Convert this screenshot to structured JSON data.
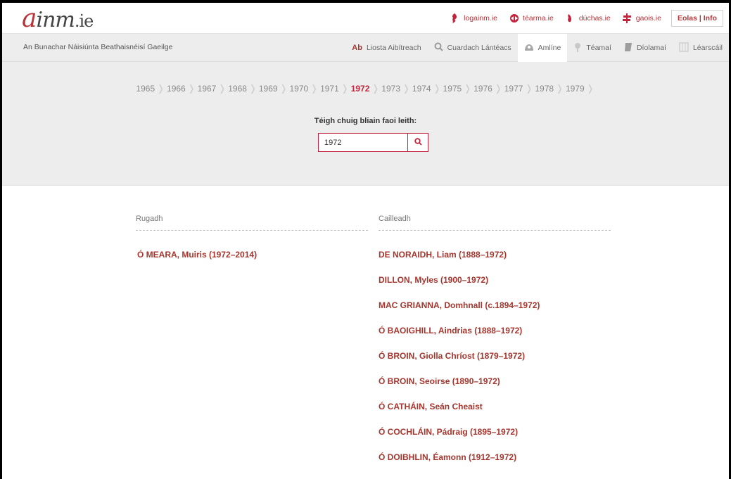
{
  "header": {
    "logo_prefix": "a",
    "logo_main": "inm",
    "logo_suffix": ".ie",
    "sitelinks": [
      {
        "label": "logainm.ie",
        "icon": "map-pin-icon"
      },
      {
        "label": "téarma.ie",
        "icon": "arrows-icon"
      },
      {
        "label": "dúchas.ie",
        "icon": "drop-icon"
      },
      {
        "label": "gaois.ie",
        "icon": "gaois-icon"
      }
    ],
    "info_button": "Eolas | Info"
  },
  "nav": {
    "subtitle": "An Bunachar Náisiúnta Beathaisnéisí Gaeilge",
    "tabs": [
      {
        "label": "Liosta Aibítreach",
        "icon": "ab-icon",
        "active": false
      },
      {
        "label": "Cuardach Lántéacs",
        "icon": "search-icon",
        "active": false
      },
      {
        "label": "Amlíne",
        "icon": "timeline-icon",
        "active": true
      },
      {
        "label": "Téamaí",
        "icon": "tree-icon",
        "active": false
      },
      {
        "label": "Díolamaí",
        "icon": "book-icon",
        "active": false
      },
      {
        "label": "Léarscáil",
        "icon": "map-icon",
        "active": false
      }
    ]
  },
  "timeline": {
    "years": [
      "1965",
      "1966",
      "1967",
      "1968",
      "1969",
      "1970",
      "1971",
      "1972",
      "1973",
      "1974",
      "1975",
      "1976",
      "1977",
      "1978",
      "1979"
    ],
    "current_year": "1972",
    "goto_label": "Téigh chuig bliain faoi leith:",
    "input_value": "1972"
  },
  "born": {
    "heading": "Rugadh",
    "entries": [
      "Ó MEARA, Muiris (1972–2014)"
    ]
  },
  "died": {
    "heading": "Cailleadh",
    "entries": [
      "DE NORAIDH, Liam (1888–1972)",
      "DILLON, Myles (1900–1972)",
      "MAC GRIANNA, Domhnall (c.1894–1972)",
      "Ó BAOIGHILL, Aindrias (1888–1972)",
      "Ó BROIN, Giolla Chríost (1879–1972)",
      "Ó BROIN, Seoirse (1890–1972)",
      "Ó CATHÁIN, Seán Cheaist",
      "Ó COCHLÁIN, Pádraig (1895–1972)",
      "Ó DOIBHLIN, Éamonn (1912–1972)"
    ]
  },
  "colors": {
    "accent": "#c4233d",
    "link": "#a6352d",
    "band": "#ededed"
  }
}
